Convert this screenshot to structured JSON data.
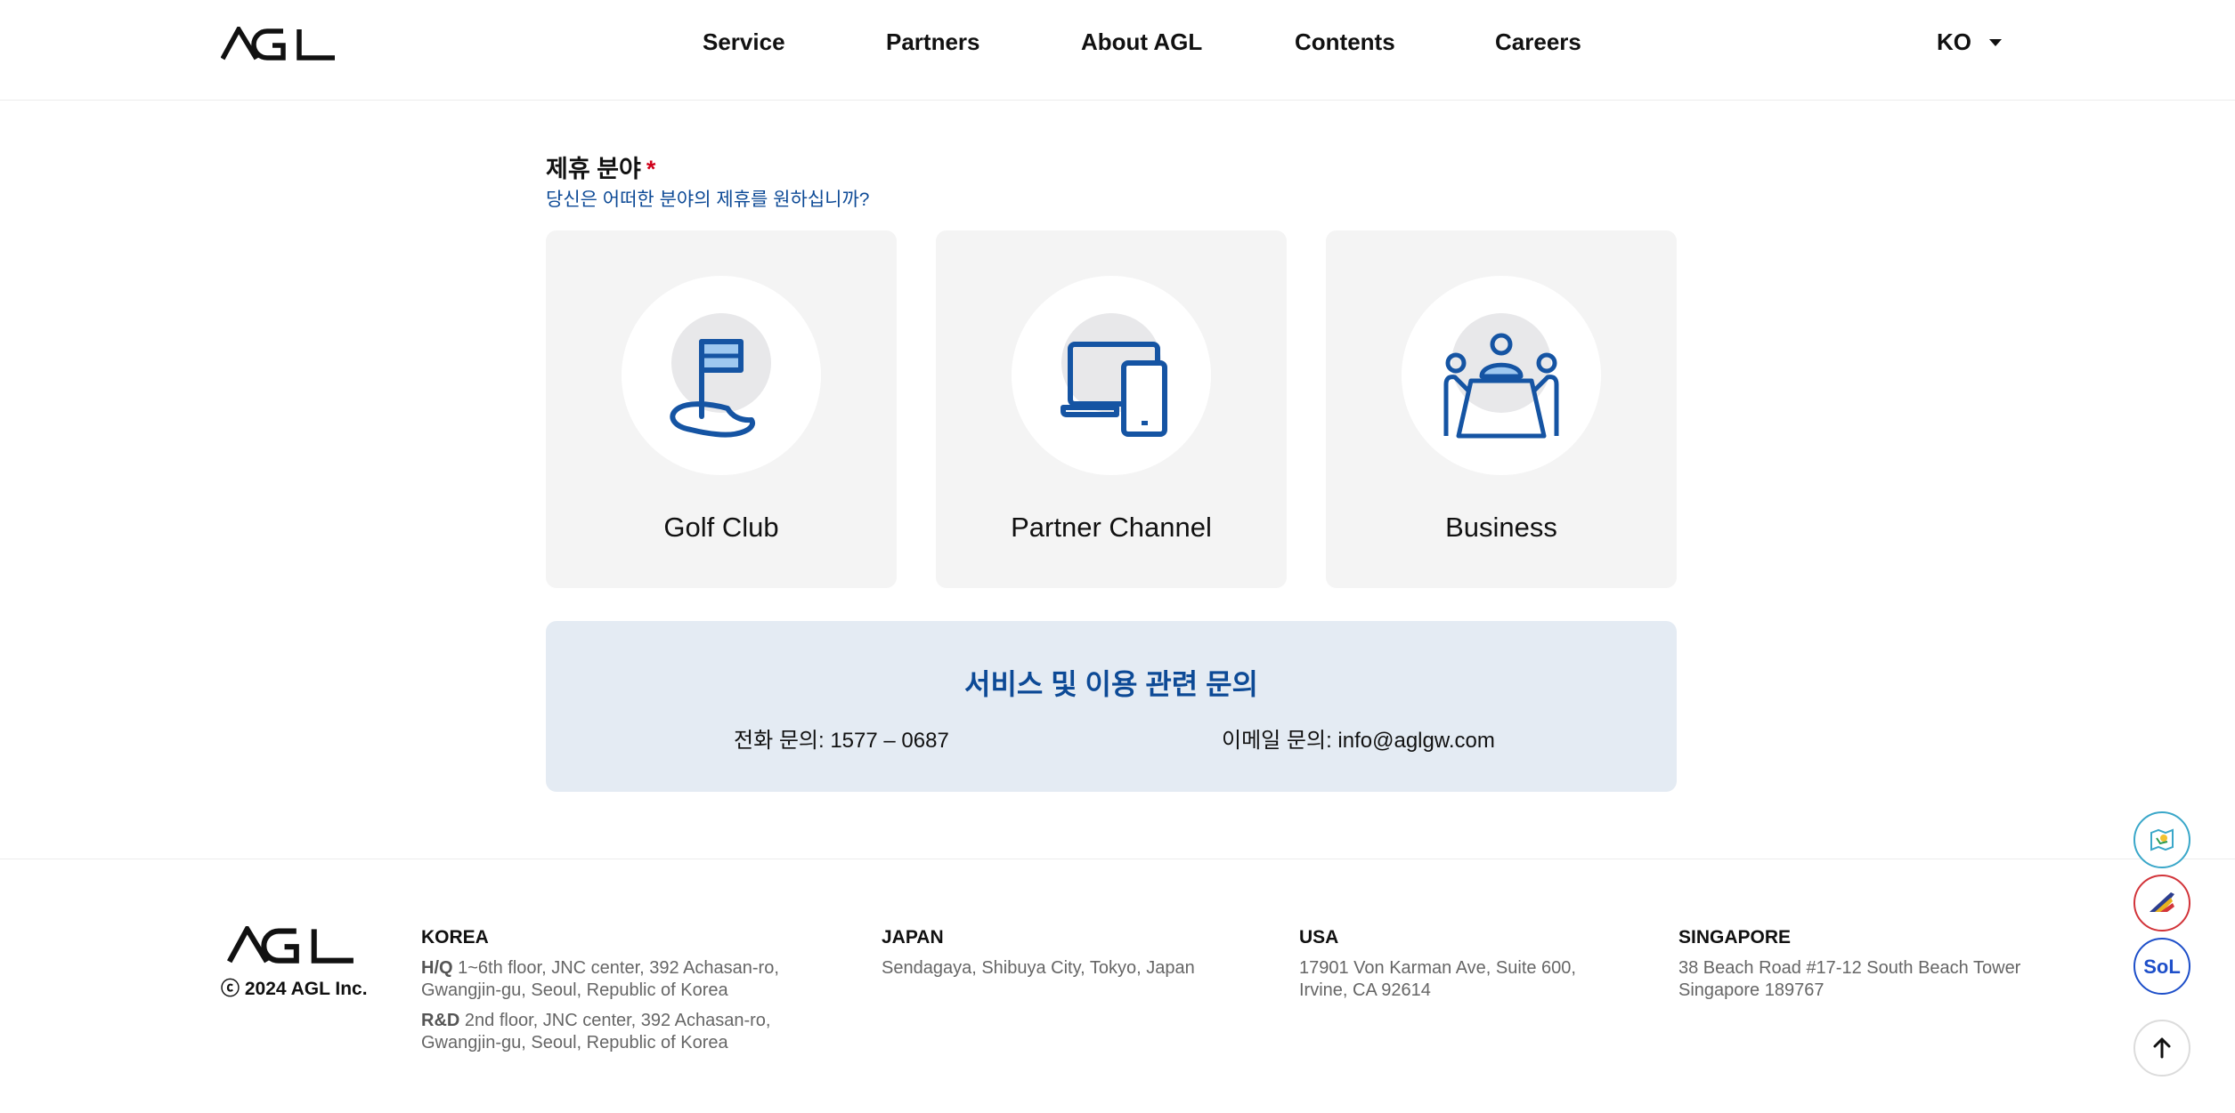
{
  "header": {
    "logo_text": "AGL",
    "nav": [
      {
        "label": "Service"
      },
      {
        "label": "Partners"
      },
      {
        "label": "About AGL"
      },
      {
        "label": "Contents"
      },
      {
        "label": "Careers"
      }
    ],
    "language": "KO"
  },
  "field": {
    "title": "제휴 분야",
    "required_mark": "*",
    "subtitle": "당신은 어떠한 분야의 제휴를 원하십니까?"
  },
  "cards": [
    {
      "label": "Golf Club",
      "icon": "golf-flag-icon"
    },
    {
      "label": "Partner Channel",
      "icon": "devices-icon"
    },
    {
      "label": "Business",
      "icon": "meeting-icon"
    }
  ],
  "inquiry": {
    "title": "서비스 및 이용 관련 문의",
    "phone_label": "전화 문의:",
    "phone": "1577 – 0687",
    "email_label": "이메일 문의:",
    "email": "info@aglgw.com"
  },
  "footer": {
    "logo_text": "AGL",
    "copyright": "ⓒ 2024 AGL Inc.",
    "offices": [
      {
        "name": "KOREA",
        "lines": [
          {
            "tag": "H/Q",
            "text": "1~6th floor, JNC center, 392 Achasan-ro,",
            "text2": "Gwangjin-gu, Seoul, Republic of Korea"
          },
          {
            "tag": "R&D",
            "text": "2nd floor, JNC center, 392 Achasan-ro,",
            "text2": "Gwangjin-gu, Seoul, Republic of Korea"
          }
        ]
      },
      {
        "name": "JAPAN",
        "line1": "Sendagaya, Shibuya City, Tokyo, Japan"
      },
      {
        "name": "USA",
        "line1": "17901 Von Karman Ave, Suite 600,",
        "line2": "Irvine, CA 92614"
      },
      {
        "name": "SINGAPORE",
        "line1": "38 Beach Road #17-12 South Beach Tower",
        "line2": "Singapore 189767"
      }
    ]
  },
  "floating": [
    {
      "icon": "map-icon",
      "color": "#3aa7c9"
    },
    {
      "icon": "airline-icon",
      "color": "#d2343a"
    },
    {
      "icon": "sol-icon",
      "color": "#1e4fc9",
      "text": "SoL"
    },
    {
      "icon": "arrow-up-icon"
    }
  ],
  "colors": {
    "brand_blue": "#0d4a96",
    "icon_blue": "#1554a3",
    "icon_light": "#9ec8f0",
    "required_red": "#d0021b",
    "card_bg": "#f4f4f4",
    "inquiry_bg": "#e4ebf3"
  }
}
